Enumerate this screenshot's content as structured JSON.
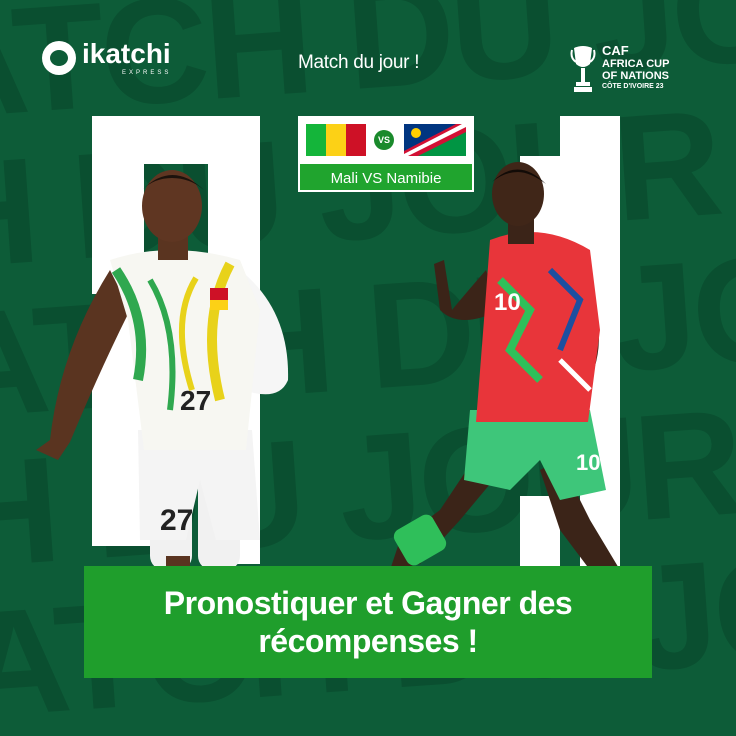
{
  "brand": {
    "name": "ikatchi",
    "tagline": "EXPRESS"
  },
  "header": {
    "title": "Match du jour !"
  },
  "caf": {
    "line1": "CAF",
    "line2": "AFRICA CUP",
    "line3": "OF NATIONS",
    "line4": "CÔTE D'IVOIRE 23"
  },
  "match": {
    "vs": "VS",
    "label": "Mali VS Namibie"
  },
  "banner": {
    "line1": "Pronostiquer et Gagner des",
    "line2": "récompenses !"
  },
  "colors": {
    "background": "#0d5c38",
    "accent_green": "#1f9e2c",
    "mali": [
      "#14b53a",
      "#fcd116",
      "#ce1126"
    ],
    "namibia": [
      "#003580",
      "#d21034",
      "#009543",
      "#ffce00"
    ]
  }
}
